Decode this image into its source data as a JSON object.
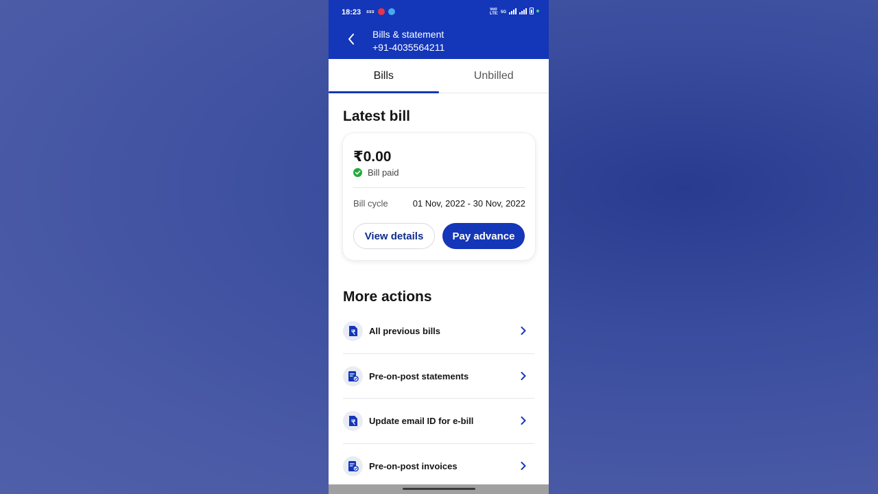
{
  "status_bar": {
    "time": "18:23",
    "left_icons": [
      "sss-icon",
      "youtube-icon",
      "app-icon"
    ],
    "sss_text": "sss",
    "net_text_1": "Vo0 LTE1",
    "net_text_2": "5G",
    "right_icons": [
      "volte-icon",
      "signal-icon",
      "signal-icon",
      "battery-icon",
      "notification-dot"
    ]
  },
  "header": {
    "title": "Bills & statement",
    "phone": "+91-4035564211",
    "back_icon": "chevron-left-icon",
    "color": "#1436b8"
  },
  "tabs": [
    {
      "label": "Bills",
      "active": true
    },
    {
      "label": "Unbilled",
      "active": false
    }
  ],
  "latest_bill": {
    "heading": "Latest bill",
    "amount": "₹0.00",
    "status": "Bill paid",
    "status_color": "#25ab3c",
    "cycle_label": "Bill cycle",
    "cycle_value": "01 Nov, 2022 - 30 Nov, 2022",
    "view_details": "View details",
    "pay_advance": "Pay advance"
  },
  "more_actions": {
    "heading": "More actions",
    "items": [
      {
        "label": "All previous bills",
        "icon": "rupee-document-icon"
      },
      {
        "label": "Pre-on-post statements",
        "icon": "statement-check-icon"
      },
      {
        "label": "Update email ID for e-bill",
        "icon": "rupee-document-icon"
      },
      {
        "label": "Pre-on-post invoices",
        "icon": "statement-check-icon"
      }
    ]
  }
}
